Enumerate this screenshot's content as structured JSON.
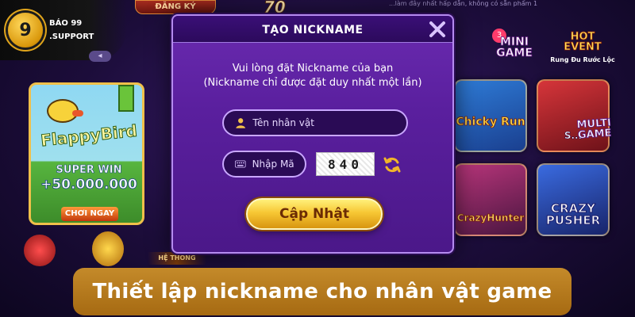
{
  "brand": {
    "logo_glyph": "9",
    "line1": "BÁO 99",
    "line2": ".SUPPORT"
  },
  "lobby": {
    "register_tab": "ĐĂNG KÝ",
    "top_ticker": "...làm đây nhất hấp dẫn, không có sẵn phẩm 1",
    "number_fragment": "70",
    "back_label": "◂",
    "flappy": {
      "title": "FlappyBird",
      "super_win": "SUPER WIN",
      "amount": "+50.000.000",
      "play_label": "CHƠI NGAY"
    },
    "mini_game": {
      "badge": "3",
      "label_line1": "MINI",
      "label_line2": "GAME"
    },
    "hot_event": {
      "line1": "HOT",
      "line2": "EVENT",
      "sub": "Rung Đu Rước Lộc"
    },
    "multi_game": {
      "line1": "MULTI",
      "line2": "GAME"
    },
    "games": {
      "chicken": "Chicky Run",
      "spin": "S...",
      "hunter": "CrazyHunter",
      "pusher_line1": "CRAZY",
      "pusher_line2": "PUSHER"
    },
    "system_label": "HỆ THỐNG"
  },
  "modal": {
    "title": "TẠO NICKNAME",
    "instruction_line1": "Vui lòng đặt Nickname của bạn",
    "instruction_line2": "(Nickname chỉ được đặt duy nhất một lần)",
    "name_field": {
      "placeholder": "Tên nhân vật",
      "value": ""
    },
    "captcha_field": {
      "placeholder": "Nhập Mã",
      "value": ""
    },
    "captcha_code": "840",
    "submit_label": "Cập Nhật",
    "icons": {
      "close": "close-icon",
      "user": "user-icon",
      "keyboard": "keyboard-icon",
      "refresh": "refresh-icon"
    }
  },
  "caption": {
    "text": "Thiết lập nickname cho nhân vật game"
  },
  "colors": {
    "modal_bg": "#5a1f9e",
    "modal_header": "#2c0a5c",
    "field_border": "#c9a7ff",
    "button_gold": "#f7c734",
    "caption_bg": "#b67a1e"
  }
}
